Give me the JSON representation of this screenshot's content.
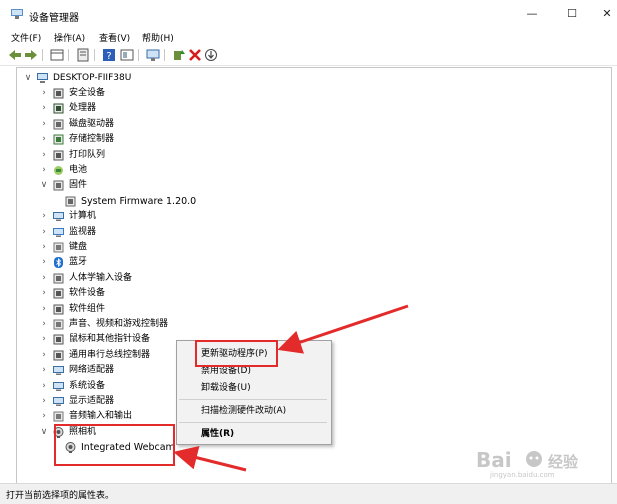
{
  "window": {
    "title": "设备管理器",
    "minimize": "—",
    "maximize": "☐",
    "close": "✕"
  },
  "menu": [
    "文件(F)",
    "操作(A)",
    "查看(V)",
    "帮助(H)"
  ],
  "tree": {
    "root": "DESKTOP-FIIF38U",
    "items": [
      {
        "label": "安全设备",
        "icon": "security-icon",
        "expanded": false
      },
      {
        "label": "处理器",
        "icon": "processor-icon",
        "expanded": false
      },
      {
        "label": "磁盘驱动器",
        "icon": "disk-drive-icon",
        "expanded": false
      },
      {
        "label": "存储控制器",
        "icon": "storage-controller-icon",
        "expanded": false
      },
      {
        "label": "打印队列",
        "icon": "printer-icon",
        "expanded": false
      },
      {
        "label": "电池",
        "icon": "battery-icon",
        "expanded": false
      },
      {
        "label": "固件",
        "icon": "firmware-icon",
        "expanded": true
      },
      {
        "label": "System Firmware 1.20.0",
        "icon": "firmware-icon",
        "child": true
      },
      {
        "label": "计算机",
        "icon": "computer-icon",
        "expanded": false
      },
      {
        "label": "监视器",
        "icon": "monitor-icon",
        "expanded": false
      },
      {
        "label": "键盘",
        "icon": "keyboard-icon",
        "expanded": false
      },
      {
        "label": "蓝牙",
        "icon": "bluetooth-icon",
        "expanded": false
      },
      {
        "label": "人体学输入设备",
        "icon": "hid-icon",
        "expanded": false
      },
      {
        "label": "软件设备",
        "icon": "software-device-icon",
        "expanded": false
      },
      {
        "label": "软件组件",
        "icon": "software-component-icon",
        "expanded": false
      },
      {
        "label": "声音、视频和游戏控制器",
        "icon": "audio-icon",
        "expanded": false
      },
      {
        "label": "鼠标和其他指针设备",
        "icon": "mouse-icon",
        "expanded": false
      },
      {
        "label": "通用串行总线控制器",
        "icon": "usb-icon",
        "expanded": false
      },
      {
        "label": "网络适配器",
        "icon": "network-icon",
        "expanded": false
      },
      {
        "label": "系统设备",
        "icon": "system-device-icon",
        "expanded": false
      },
      {
        "label": "显示适配器",
        "icon": "display-adapter-icon",
        "expanded": false
      },
      {
        "label": "音频输入和输出",
        "icon": "audio-io-icon",
        "expanded": false
      },
      {
        "label": "照相机",
        "icon": "camera-icon",
        "expanded": true
      },
      {
        "label": "Integrated Webcam",
        "icon": "webcam-icon",
        "child": true
      }
    ]
  },
  "context_menu": {
    "update_driver": "更新驱动程序(P)",
    "disable": "禁用设备(D)",
    "uninstall": "卸载设备(U)",
    "scan": "扫描检测硬件改动(A)",
    "properties": "属性(R)"
  },
  "status": "打开当前选择项的属性表。",
  "watermark": {
    "brand": "Bai",
    "suffix": "经验",
    "sub": "jingyan.baidu.com"
  },
  "colors": {
    "highlight": "#e32b2b",
    "accent": "#1e6fd9"
  }
}
